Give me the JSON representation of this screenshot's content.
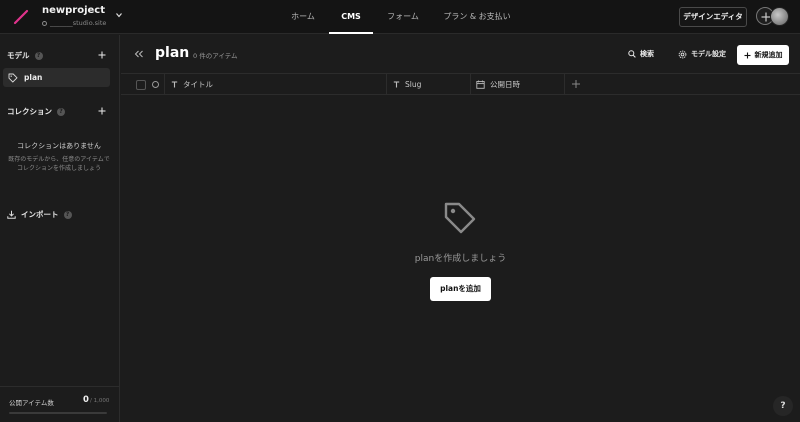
{
  "colors": {
    "accent_logo": "#e0338c",
    "background": "#1c1c1c",
    "topbar": "#141414",
    "primary_button": "#ffffff"
  },
  "project": {
    "name": "newproject",
    "url": "_______studio.site"
  },
  "nav": {
    "tabs": [
      {
        "label": "ホーム"
      },
      {
        "label": "CMS",
        "active": true
      },
      {
        "label": "フォーム"
      },
      {
        "label": "プラン & お支払い"
      }
    ],
    "design_editor_label": "デザインエディタ"
  },
  "sidebar": {
    "models_heading": "モデル",
    "help_glyph": "?",
    "models": [
      {
        "label": "plan",
        "icon": "tag-icon"
      }
    ],
    "collections_heading": "コレクション",
    "empty_collections_title": "コレクションはありません",
    "empty_collections_desc_1": "既存のモデルから、任意のアイテムで",
    "empty_collections_desc_2": "コレクションを作成しましょう",
    "import_label": "インポート",
    "footer": {
      "label": "公開アイテム数",
      "count": "0",
      "max": "/ 1,000",
      "used_fraction": 0
    }
  },
  "main": {
    "title": "plan",
    "item_count": "0 件のアイテム",
    "search_label": "検索",
    "model_settings_label": "モデル設定",
    "new_button_label": "新規追加",
    "columns": [
      {
        "label": "タイトル",
        "icon": "text-type-icon"
      },
      {
        "label": "Slug",
        "icon": "text-type-icon"
      },
      {
        "label": "公開日時",
        "icon": "calendar-icon"
      }
    ],
    "empty_message": "planを作成しましょう",
    "empty_button_label": "planを追加"
  },
  "help_fab": "?"
}
